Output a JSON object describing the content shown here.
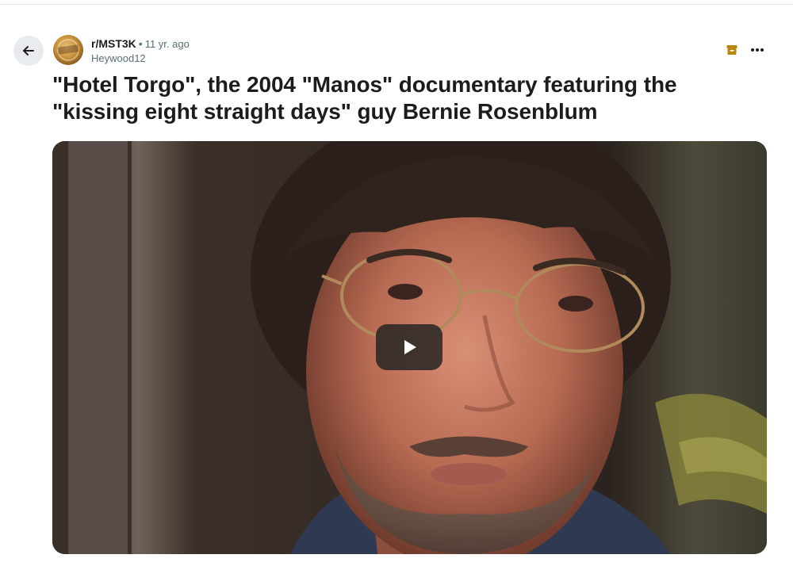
{
  "post": {
    "subreddit": "r/MST3K",
    "separator": "•",
    "time": "11 yr. ago",
    "author": "Heywood12",
    "title": "\"Hotel Torgo\", the 2004 \"Manos\" documentary featuring the \"kissing eight straight days\" guy Bernie Rosenblum"
  },
  "icons": {
    "back": "arrow-left-icon",
    "avatar": "subreddit-avatar",
    "archive": "archive-icon",
    "more": "more-horizontal-icon",
    "play": "play-icon"
  },
  "colors": {
    "archive_icon": "#b8860b",
    "muted_text": "#576f76",
    "title_text": "#1c1c1c",
    "back_button_bg": "#e9ecef"
  }
}
